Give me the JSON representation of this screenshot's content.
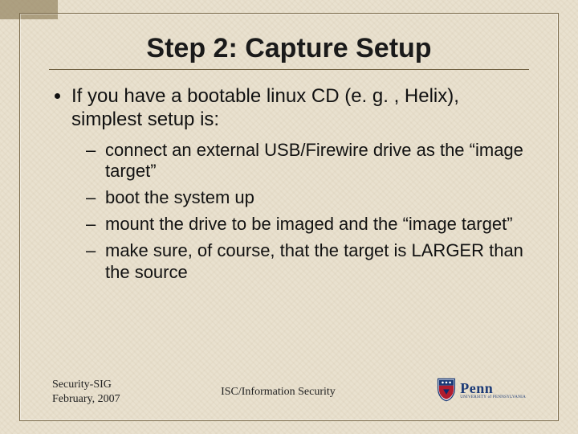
{
  "title": "Step 2: Capture Setup",
  "bullets": {
    "level1": "If you have a bootable linux CD (e. g. , Helix), simplest setup is:",
    "level2": [
      "connect an external USB/Firewire drive as the “image target”",
      "boot the system up",
      "mount the drive to be imaged and the “image target”",
      "make sure, of course, that the target is LARGER than the source"
    ]
  },
  "footer": {
    "left_line1": "Security-SIG",
    "left_line2": "February, 2007",
    "center": "ISC/Information Security",
    "logo_word": "Penn",
    "logo_sub": "UNIVERSITY of PENNSYLVANIA"
  }
}
